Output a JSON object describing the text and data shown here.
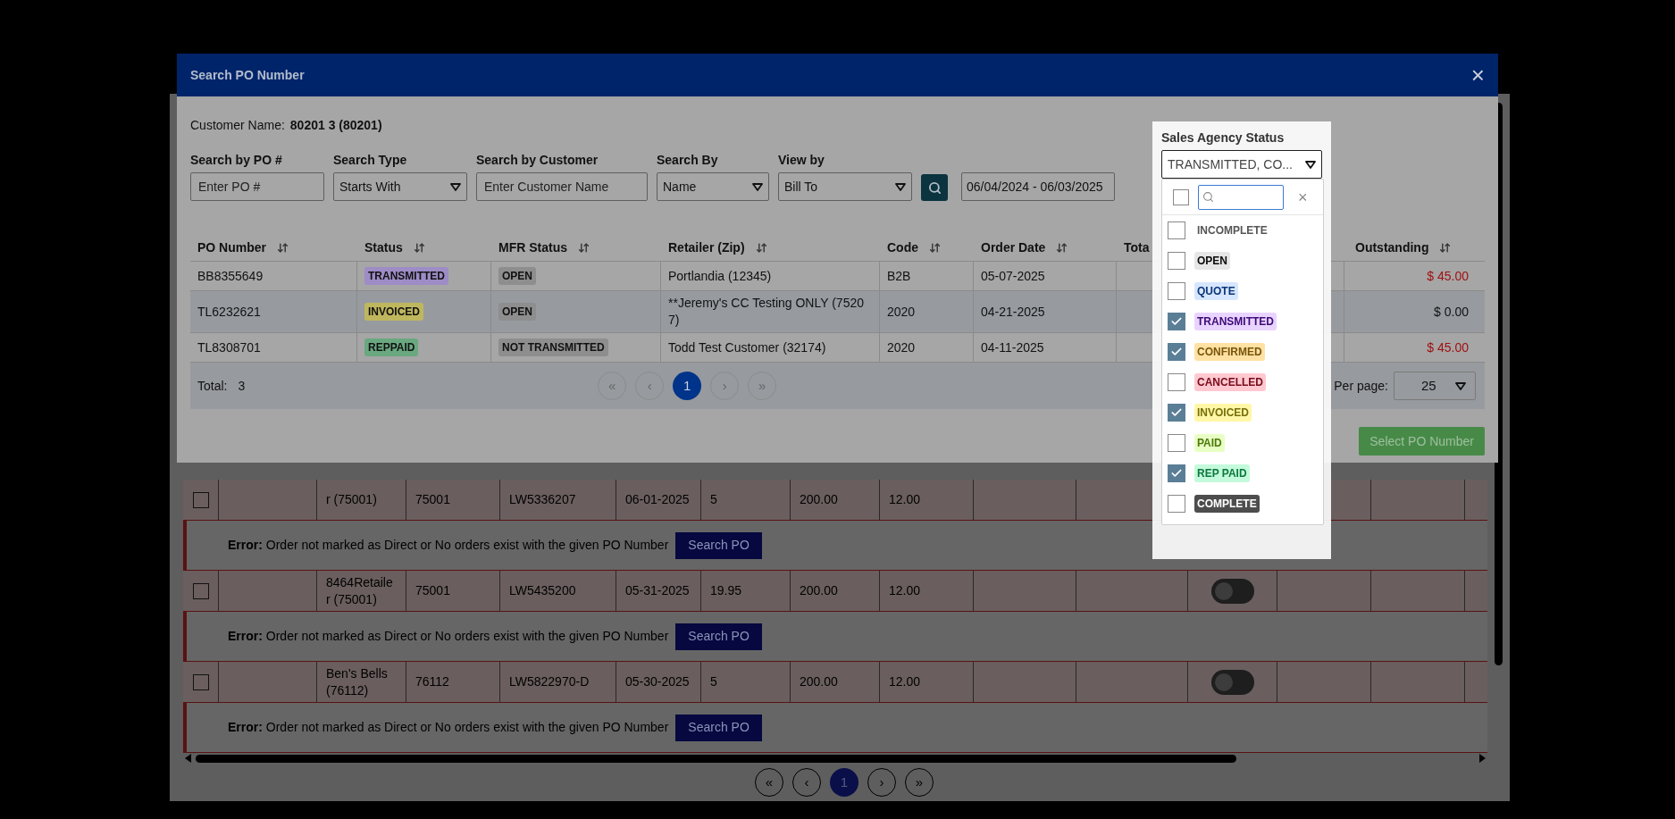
{
  "dialog": {
    "title": "Search PO Number",
    "close": "×",
    "customer_label": "Customer Name:",
    "customer_value": "80201 3 (80201)",
    "filters": [
      {
        "kind": "input",
        "label": "Search by PO #",
        "placeholder": "Enter PO #"
      },
      {
        "kind": "select",
        "label": "Search Type",
        "value": "Starts With"
      },
      {
        "kind": "input",
        "label": "Search by Customer",
        "placeholder": "Enter Customer Name"
      },
      {
        "kind": "select",
        "label": "Search By",
        "value": "Name"
      },
      {
        "kind": "select",
        "label": "View by",
        "value": "Bill To"
      }
    ],
    "date_range": "06/04/2024 - 06/03/2025",
    "sales_agency_status": {
      "label": "Sales Agency Status",
      "value": "TRANSMITTED, CO...",
      "clear": "×",
      "select_all_checked": false,
      "options": [
        {
          "label": "INCOMPLETE",
          "checked": false,
          "color": "#ffffff"
        },
        {
          "label": "OPEN",
          "checked": false,
          "color": "#e6e6e6"
        },
        {
          "label": "QUOTE",
          "checked": false,
          "color": "#d6e6ff"
        },
        {
          "label": "TRANSMITTED",
          "checked": true,
          "color": "#e8d4ff"
        },
        {
          "label": "CONFIRMED",
          "checked": true,
          "color": "#ffe2a3"
        },
        {
          "label": "CANCELLED",
          "checked": false,
          "color": "#ffc8d0"
        },
        {
          "label": "INVOICED",
          "checked": true,
          "color": "#fff7a6"
        },
        {
          "label": "PAID",
          "checked": false,
          "color": "#e8ffc4"
        },
        {
          "label": "REP PAID",
          "checked": true,
          "color": "#c4fadc"
        },
        {
          "label": "COMPLETE",
          "checked": false,
          "color": "#4d4d4d"
        }
      ]
    },
    "table": {
      "columns": [
        "PO Number",
        "Status",
        "MFR Status",
        "Retailer (Zip)",
        "Code",
        "Order Date",
        "Tota",
        "Outstanding"
      ],
      "rows": [
        {
          "po": "BB8355649",
          "status": "TRANSMITTED",
          "color": "#9d8cc6",
          "mfr_status": "OPEN",
          "retailer": "Portlandia (12345)",
          "code": "B2B",
          "order_date": "05-07-2025",
          "outstanding": "$ 45.00",
          "due": true
        },
        {
          "po": "TL6232621",
          "status": "INVOICED",
          "color": "#bfb75e",
          "mfr_status": "OPEN",
          "retailer": "**Jeremy's CC Testing ONLY (75207)",
          "code": "2020",
          "order_date": "04-21-2025",
          "outstanding": "$ 0.00",
          "due": false
        },
        {
          "po": "TL8308701",
          "status": "REPPAID",
          "color": "#6aa880",
          "mfr_status": "NOT TRANSMITTED",
          "retailer": "Todd Test Customer (32174)",
          "code": "2020",
          "order_date": "04-11-2025",
          "outstanding": "$ 45.00",
          "due": true
        }
      ],
      "total_label": "Total:",
      "total_value": "3",
      "pagination": [
        {
          "label": "«",
          "selected": false
        },
        {
          "label": "‹",
          "selected": false
        },
        {
          "label": "1",
          "selected": true
        },
        {
          "label": "›",
          "selected": false
        },
        {
          "label": "»",
          "selected": false
        }
      ],
      "per_page_label": "Per page:",
      "per_page": "25"
    },
    "select_button": "Select PO Number"
  },
  "background": {
    "rows": [
      {
        "kind": "order",
        "checked": false,
        "cells": [
          "r (75001)",
          "75001",
          "LW5336207",
          "06-01-2025",
          "5",
          "200.00",
          "12.00"
        ]
      },
      {
        "kind": "error",
        "message": "**Error:** Order not marked as Direct or No orders exist with the given PO Number",
        "button": "Search PO"
      },
      {
        "kind": "order",
        "checked": false,
        "on": false,
        "cells": [
          "8464Retailer (75001)",
          "75001",
          "LW5435200",
          "05-31-2025",
          "19.95",
          "200.00",
          "12.00"
        ]
      },
      {
        "kind": "error",
        "message": "**Error:** Order not marked as Direct or No orders exist with the given PO Number",
        "button": "Search PO"
      },
      {
        "kind": "order",
        "checked": false,
        "on": false,
        "cells": [
          "Ben's Bells (76112)",
          "76112",
          "LW5822970-D",
          "05-30-2025",
          "5",
          "200.00",
          "12.00"
        ]
      },
      {
        "kind": "error",
        "message": "**Error:** Order not marked as Direct or No orders exist with the given PO Number",
        "button": "Search PO"
      }
    ],
    "pagination": [
      {
        "label": "«",
        "selected": false
      },
      {
        "label": "‹",
        "selected": false
      },
      {
        "label": "1",
        "selected": true
      },
      {
        "label": "›",
        "selected": false
      },
      {
        "label": "»",
        "selected": false
      }
    ]
  }
}
